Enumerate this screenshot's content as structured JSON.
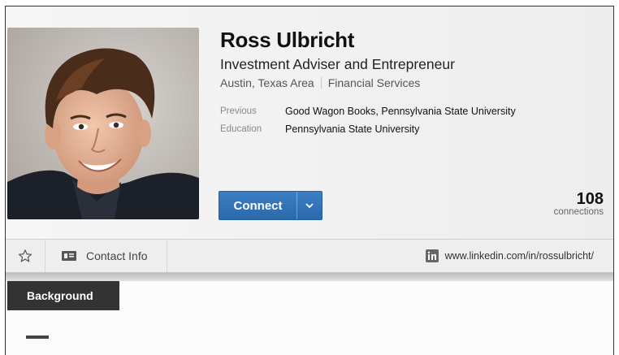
{
  "profile": {
    "name": "Ross Ulbricht",
    "headline": "Investment Adviser and Entrepreneur",
    "location": "Austin, Texas Area",
    "industry": "Financial Services",
    "previous_label": "Previous",
    "previous_value": "Good Wagon Books, Pennsylvania State University",
    "education_label": "Education",
    "education_value": "Pennsylvania State University"
  },
  "actions": {
    "connect_label": "Connect"
  },
  "connections": {
    "count": "108",
    "label": "connections"
  },
  "infobar": {
    "contact_label": "Contact Info",
    "profile_url": "www.linkedin.com/in/rossulbricht/"
  },
  "sections": {
    "background_label": "Background"
  },
  "colors": {
    "accent": "#2a69aa",
    "tab_dark": "#333333"
  }
}
